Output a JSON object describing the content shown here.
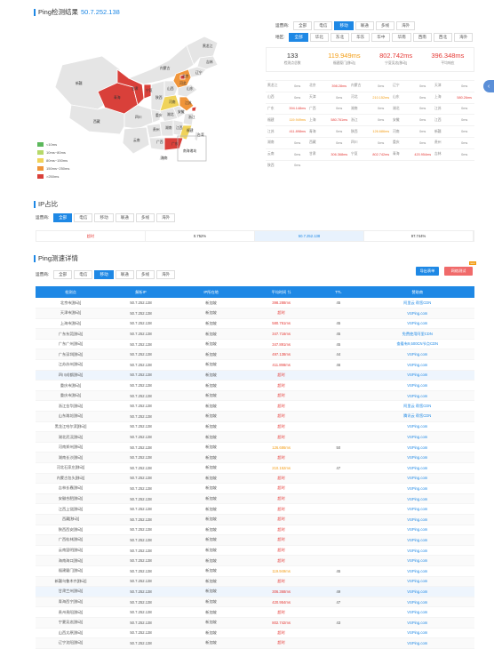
{
  "ping_title": "Ping检测结果",
  "ip": "50.7.252.138",
  "isp_filter": {
    "label": "运营商:",
    "options": [
      "全部",
      "电信",
      "移动",
      "联通",
      "多线",
      "海外"
    ],
    "active": 2
  },
  "region_filter": {
    "label": "地区:",
    "options": [
      "全部",
      "华北",
      "东北",
      "华东",
      "华中",
      "华南",
      "西南",
      "西北",
      "海外"
    ],
    "active": 0
  },
  "legend": [
    {
      "label": "<10ms",
      "color": "#5cb85c"
    },
    {
      "label": "10ms~80ms",
      "color": "#b6d96a"
    },
    {
      "label": "80ms~150ms",
      "color": "#f0d35a"
    },
    {
      "label": "150ms~250ms",
      "color": "#f0953a"
    },
    {
      "label": ">250ms",
      "color": "#d9403a"
    }
  ],
  "stats": [
    {
      "value": "133",
      "key": "检测点总数",
      "color": "#333"
    },
    {
      "value": "119.949ms",
      "key": "福建厦门[移动]",
      "color": "#f39c12"
    },
    {
      "value": "802.742ms",
      "key": "宁夏吴忠[移动]",
      "color": "#e53935"
    },
    {
      "value": "396.348ms",
      "key": "平均响应",
      "color": "#e53935"
    }
  ],
  "province_grid": [
    [
      [
        "黑龙江",
        "0ms"
      ],
      [
        "北京",
        "398.28ms"
      ],
      [
        "内蒙古",
        "0ms"
      ],
      [
        "辽宁",
        "0ms"
      ],
      [
        "天津",
        "0ms"
      ]
    ],
    [
      [
        "山西",
        "0ms"
      ],
      [
        "天津",
        "0ms"
      ],
      [
        "河北",
        "210.152ms"
      ],
      [
        "山东",
        "0ms"
      ],
      [
        "上海",
        "580.26ms"
      ]
    ],
    [
      [
        "广东",
        "394.148ms"
      ],
      [
        "广西",
        "0ms"
      ],
      [
        "湖南",
        "0ms"
      ],
      [
        "湖北",
        "0ms"
      ],
      [
        "江苏",
        "0ms"
      ]
    ],
    [
      [
        "福建",
        "119.949ms"
      ],
      [
        "上海",
        "580.761ms"
      ],
      [
        "浙江",
        "0ms"
      ],
      [
        "安徽",
        "0ms"
      ],
      [
        "江西",
        "0ms"
      ]
    ],
    [
      [
        "江苏",
        "411.898ms"
      ],
      [
        "青海",
        "0ms"
      ],
      [
        "陕西",
        "126.686ms"
      ],
      [
        "河南",
        "0ms"
      ],
      [
        "新疆",
        "0ms"
      ]
    ],
    [
      [
        "湖南",
        "0ms"
      ],
      [
        "西藏",
        "0ms"
      ],
      [
        "四川",
        "0ms"
      ],
      [
        "重庆",
        "0ms"
      ],
      [
        "贵州",
        "0ms"
      ]
    ],
    [
      [
        "云南",
        "0ms"
      ],
      [
        "甘肃",
        "306.368ms"
      ],
      [
        "宁夏",
        "802.742ms"
      ],
      [
        "青海",
        "420.954ms"
      ],
      [
        "吉林",
        "0ms"
      ]
    ],
    [
      [
        "陕西",
        "0ms"
      ]
    ]
  ],
  "ip_title": "IP占比",
  "ip_isp": {
    "label": "运营商:",
    "options": [
      "全部",
      "电信",
      "移动",
      "联通",
      "多线",
      "海外"
    ],
    "active": 0
  },
  "ip_bar": [
    "超时",
    "0.752%",
    "50.7.252.138",
    "97.744%"
  ],
  "detail_title": "Ping测速详情",
  "detail_isp": {
    "label": "运营商:",
    "options": [
      "全部",
      "电信",
      "移动",
      "联通",
      "多线",
      "海外"
    ],
    "active": 2
  },
  "export_btn": "导出表单",
  "compare_btn": "网络测试",
  "new_badge": "new",
  "table": {
    "headers": [
      "检测点",
      "解析IP",
      "IP所在地",
      "平均时间 ⇅",
      "TTL",
      "赞助商"
    ],
    "rows": [
      [
        "北京市[移动]",
        "50.7.252.138",
        "新加坡",
        "398.288ms",
        "45",
        "阿里云 帮您CDN"
      ],
      [
        "天津市[移动]",
        "50.7.252.138",
        "新加坡",
        "超时",
        "",
        "VSPing.com"
      ],
      [
        "上海市[移动]",
        "50.7.252.138",
        "新加坡",
        "580.761ms",
        "45",
        "VSPing.com"
      ],
      [
        "广东东莞[移动]",
        "50.7.252.138",
        "新加坡",
        "347.716ms",
        "45",
        "免费使用阿里CDN"
      ],
      [
        "广东广州[移动]",
        "50.7.252.138",
        "新加坡",
        "347.891ms",
        "45",
        "查看有9,500CN节点CDN"
      ],
      [
        "广东深圳[移动]",
        "50.7.252.138",
        "新加坡",
        "497.138ms",
        "44",
        "VSPing.com"
      ],
      [
        "江苏苏州[移动]",
        "50.7.252.138",
        "新加坡",
        "411.898ms",
        "46",
        "VSPing.com"
      ],
      [
        "四川成都[移动]",
        "50.7.252.138",
        "新加坡",
        "超时",
        "",
        "VSPing.com"
      ],
      [
        "重庆市[移动]",
        "50.7.252.138",
        "新加坡",
        "超时",
        "",
        "VSPing.com"
      ],
      [
        "重庆市[移动]",
        "50.7.252.138",
        "新加坡",
        "超时",
        "",
        "VSPing.com"
      ],
      [
        "浙江金华[移动]",
        "50.7.252.138",
        "新加坡",
        "超时",
        "",
        "阿里云 帮您CDN"
      ],
      [
        "山东潍坊[移动]",
        "50.7.252.138",
        "新加坡",
        "超时",
        "",
        "腾讯云 帮您CDN"
      ],
      [
        "黑龙江哈尔滨[移动]",
        "50.7.252.138",
        "新加坡",
        "超时",
        "",
        "VSPing.com"
      ],
      [
        "湖北武汉[移动]",
        "50.7.252.138",
        "新加坡",
        "超时",
        "",
        "VSPing.com"
      ],
      [
        "河南郑州[移动]",
        "50.7.252.138",
        "新加坡",
        "126.686ms",
        "50",
        "VSPing.com"
      ],
      [
        "湖南长沙[移动]",
        "50.7.252.138",
        "新加坡",
        "超时",
        "",
        "VSPing.com"
      ],
      [
        "河北石家庄[移动]",
        "50.7.252.138",
        "新加坡",
        "210.152ms",
        "47",
        "VSPing.com"
      ],
      [
        "内蒙古包头[移动]",
        "50.7.252.138",
        "新加坡",
        "超时",
        "",
        "VSPing.com"
      ],
      [
        "吉林长春[移动]",
        "50.7.252.138",
        "新加坡",
        "超时",
        "",
        "VSPing.com"
      ],
      [
        "安徽合肥[移动]",
        "50.7.252.138",
        "新加坡",
        "超时",
        "",
        "VSPing.com"
      ],
      [
        "江西上饶[移动]",
        "50.7.252.138",
        "新加坡",
        "超时",
        "",
        "VSPing.com"
      ],
      [
        "西藏[移动]",
        "50.7.252.138",
        "新加坡",
        "超时",
        "",
        "VSPing.com"
      ],
      [
        "陕西西安[移动]",
        "50.7.252.138",
        "新加坡",
        "超时",
        "",
        "VSPing.com"
      ],
      [
        "广西桂林[移动]",
        "50.7.252.138",
        "新加坡",
        "超时",
        "",
        "VSPing.com"
      ],
      [
        "云南昆明[移动]",
        "50.7.252.138",
        "新加坡",
        "超时",
        "",
        "VSPing.com"
      ],
      [
        "海南海口[移动]",
        "50.7.252.138",
        "新加坡",
        "超时",
        "",
        "VSPing.com"
      ],
      [
        "福建厦门[移动]",
        "50.7.252.138",
        "新加坡",
        "119.949ms",
        "45",
        "VSPing.com"
      ],
      [
        "新疆乌鲁木齐[移动]",
        "50.7.252.138",
        "新加坡",
        "超时",
        "",
        "VSPing.com"
      ],
      [
        "甘肃兰州[移动]",
        "50.7.252.138",
        "新加坡",
        "306.368ms",
        "49",
        "VSPing.com"
      ],
      [
        "青海西宁[移动]",
        "50.7.252.138",
        "新加坡",
        "420.954ms",
        "47",
        "VSPing.com"
      ],
      [
        "贵州贵阳[移动]",
        "50.7.252.138",
        "新加坡",
        "超时",
        "",
        "VSPing.com"
      ],
      [
        "宁夏吴忠[移动]",
        "50.7.252.138",
        "新加坡",
        "802.742ms",
        "43",
        "VSPing.com"
      ],
      [
        "山西太原[移动]",
        "50.7.252.138",
        "新加坡",
        "超时",
        "",
        "VSPing.com"
      ],
      [
        "辽宁沈阳[移动]",
        "50.7.252.138",
        "新加坡",
        "超时",
        "",
        "VSPing.com"
      ]
    ]
  },
  "map_labels": [
    "新疆",
    "西藏",
    "青海",
    "甘肃",
    "内蒙古",
    "黑龙江",
    "吉林",
    "辽宁",
    "北京",
    "河北",
    "山西",
    "陕西",
    "四川",
    "重庆",
    "湖北",
    "河南",
    "山东",
    "江苏",
    "安徽",
    "浙江",
    "湖南",
    "江西",
    "福建",
    "广东",
    "广西",
    "贵州",
    "云南",
    "海南",
    "台湾",
    "宁夏",
    "南海诸岛"
  ]
}
